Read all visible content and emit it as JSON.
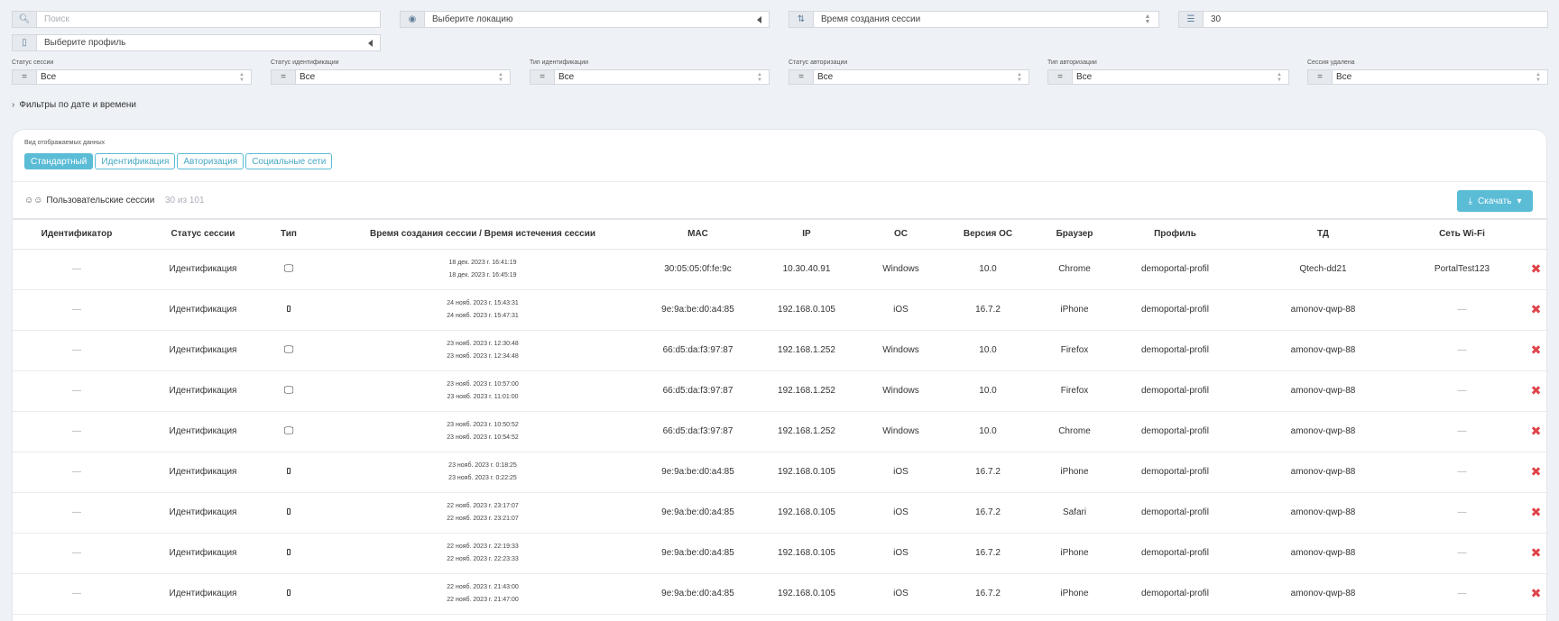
{
  "filters": {
    "search_placeholder": "Поиск",
    "location_placeholder": "Выберите локацию",
    "sort_value": "Время создания сессии",
    "page_size": "30",
    "profile_placeholder": "Выберите профиль",
    "selects": [
      {
        "label": "Статус сессии",
        "eq": "=",
        "value": "Все"
      },
      {
        "label": "Статус идентификации",
        "eq": "=",
        "value": "Все"
      },
      {
        "label": "Тип идентификации",
        "eq": "=",
        "value": "Все"
      },
      {
        "label": "Статус авторизации",
        "eq": "=",
        "value": "Все"
      },
      {
        "label": "Тип авторизации",
        "eq": "=",
        "value": "Все"
      },
      {
        "label": "Сессия удалена",
        "eq": "=",
        "value": "Все"
      }
    ],
    "date_filters_label": "Фильтры по дате и времени"
  },
  "view": {
    "label": "Вид отображаемых данных",
    "tabs": [
      "Стандартный",
      "Идентификация",
      "Авторизация",
      "Социальные сети"
    ]
  },
  "sessions": {
    "title": "Пользовательские сессии",
    "count": "30 из 101",
    "download_label": "Скачать"
  },
  "table": {
    "headers": [
      "Идентификатор",
      "Статус сессии",
      "Тип",
      "Время создания сессии / Время истечения сессии",
      "MAC",
      "IP",
      "ОС",
      "Версия ОС",
      "Браузер",
      "Профиль",
      "ТД",
      "Сеть Wi-Fi",
      ""
    ],
    "rows": [
      {
        "id": "—",
        "status": "Идентификация",
        "type": "desktop",
        "created": "18 дек. 2023 г. 16:41:19",
        "expires": "18 дек. 2023 г. 16:45:19",
        "mac": "30:05:05:0f:fe:9c",
        "ip": "10.30.40.91",
        "os": "Windows",
        "os_version": "10.0",
        "browser": "Chrome",
        "profile": "demoportal-profil",
        "ap": "Qtech-dd21",
        "wifi": "PortalTest123"
      },
      {
        "id": "—",
        "status": "Идентификация",
        "type": "mobile",
        "created": "24 нояб. 2023 г. 15:43:31",
        "expires": "24 нояб. 2023 г. 15:47:31",
        "mac": "9e:9a:be:d0:a4:85",
        "ip": "192.168.0.105",
        "os": "iOS",
        "os_version": "16.7.2",
        "browser": "iPhone",
        "profile": "demoportal-profil",
        "ap": "amonov-qwp-88",
        "wifi": "—"
      },
      {
        "id": "—",
        "status": "Идентификация",
        "type": "desktop",
        "created": "23 нояб. 2023 г. 12:30:48",
        "expires": "23 нояб. 2023 г. 12:34:48",
        "mac": "66:d5:da:f3:97:87",
        "ip": "192.168.1.252",
        "os": "Windows",
        "os_version": "10.0",
        "browser": "Firefox",
        "profile": "demoportal-profil",
        "ap": "amonov-qwp-88",
        "wifi": "—"
      },
      {
        "id": "—",
        "status": "Идентификация",
        "type": "desktop",
        "created": "23 нояб. 2023 г. 10:57:00",
        "expires": "23 нояб. 2023 г. 11:01:00",
        "mac": "66:d5:da:f3:97:87",
        "ip": "192.168.1.252",
        "os": "Windows",
        "os_version": "10.0",
        "browser": "Firefox",
        "profile": "demoportal-profil",
        "ap": "amonov-qwp-88",
        "wifi": "—"
      },
      {
        "id": "—",
        "status": "Идентификация",
        "type": "desktop",
        "created": "23 нояб. 2023 г. 10:50:52",
        "expires": "23 нояб. 2023 г. 10:54:52",
        "mac": "66:d5:da:f3:97:87",
        "ip": "192.168.1.252",
        "os": "Windows",
        "os_version": "10.0",
        "browser": "Chrome",
        "profile": "demoportal-profil",
        "ap": "amonov-qwp-88",
        "wifi": "—"
      },
      {
        "id": "—",
        "status": "Идентификация",
        "type": "mobile",
        "created": "23 нояб. 2023 г. 0:18:25",
        "expires": "23 нояб. 2023 г. 0:22:25",
        "mac": "9e:9a:be:d0:a4:85",
        "ip": "192.168.0.105",
        "os": "iOS",
        "os_version": "16.7.2",
        "browser": "iPhone",
        "profile": "demoportal-profil",
        "ap": "amonov-qwp-88",
        "wifi": "—"
      },
      {
        "id": "—",
        "status": "Идентификация",
        "type": "mobile",
        "created": "22 нояб. 2023 г. 23:17:07",
        "expires": "22 нояб. 2023 г. 23:21:07",
        "mac": "9e:9a:be:d0:a4:85",
        "ip": "192.168.0.105",
        "os": "iOS",
        "os_version": "16.7.2",
        "browser": "Safari",
        "profile": "demoportal-profil",
        "ap": "amonov-qwp-88",
        "wifi": "—"
      },
      {
        "id": "—",
        "status": "Идентификация",
        "type": "mobile",
        "created": "22 нояб. 2023 г. 22:19:33",
        "expires": "22 нояб. 2023 г. 22:23:33",
        "mac": "9e:9a:be:d0:a4:85",
        "ip": "192.168.0.105",
        "os": "iOS",
        "os_version": "16.7.2",
        "browser": "iPhone",
        "profile": "demoportal-profil",
        "ap": "amonov-qwp-88",
        "wifi": "—"
      },
      {
        "id": "—",
        "status": "Идентификация",
        "type": "mobile",
        "created": "22 нояб. 2023 г. 21:43:00",
        "expires": "22 нояб. 2023 г. 21:47:00",
        "mac": "9e:9a:be:d0:a4:85",
        "ip": "192.168.0.105",
        "os": "iOS",
        "os_version": "16.7.2",
        "browser": "iPhone",
        "profile": "demoportal-profil",
        "ap": "amonov-qwp-88",
        "wifi": "—"
      }
    ]
  },
  "icons": {
    "search": "search-icon",
    "location": "map-pin-icon",
    "sort": "sort-icon",
    "list": "list-icon",
    "profile": "document-icon",
    "users": "users-icon",
    "download": "download-icon",
    "delete": "delete-icon",
    "desktop": "desktop-icon",
    "mobile": "mobile-icon"
  },
  "colors": {
    "accent": "#5bbcd6",
    "delete": "#e0444b"
  }
}
